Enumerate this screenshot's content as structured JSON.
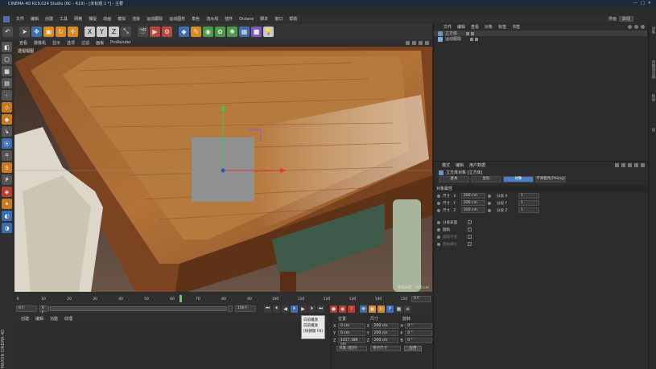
{
  "window": {
    "title": "CINEMA 4D R19.024 Studio (RC - R19) - [未标题 1 *] - 主要"
  },
  "menubar": {
    "items": [
      "文件",
      "编辑",
      "创建",
      "工具",
      "网格",
      "捕捉",
      "动画",
      "模拟",
      "渲染",
      "运动跟踪",
      "运动图形",
      "角色",
      "流水线",
      "插件",
      "Octane",
      "脚本",
      "窗口",
      "帮助"
    ],
    "layout_label": "界面",
    "layout_value": "启动"
  },
  "viewport": {
    "menu": [
      "查看",
      "摄像机",
      "显示",
      "选项",
      "过滤",
      "面板",
      "ProRender"
    ],
    "label": "透视视图",
    "grid_label": "网格间距 : 100 cm"
  },
  "timeline": {
    "ticks": [
      "0",
      "10",
      "20",
      "30",
      "40",
      "50",
      "60",
      "70",
      "80",
      "90",
      "100",
      "110",
      "120",
      "130",
      "140",
      "150"
    ],
    "current_frame": 63,
    "end_label": "0 F"
  },
  "transport": {
    "start_field": "0 F",
    "slider_start": "0 F",
    "slider_end": "150 F",
    "end_field": "150 F"
  },
  "tooltip": {
    "lines": [
      "向前播放",
      "向前播放",
      "[快捷键 F8]"
    ]
  },
  "material_panel": {
    "menu": [
      "创建",
      "编辑",
      "功能",
      "纹理"
    ]
  },
  "coordinates": {
    "headers": [
      "位置",
      "尺寸",
      "旋转"
    ],
    "rows": [
      {
        "axis": "X",
        "pos": "0 cm",
        "size": "200 cm",
        "rot_axis": "H",
        "rot": "0 °"
      },
      {
        "axis": "Y",
        "pos": "0 cm",
        "size": "200 cm",
        "rot_axis": "P",
        "rot": "0 °"
      },
      {
        "axis": "Z",
        "pos": "1417.189 cm",
        "size": "200 cm",
        "rot_axis": "B",
        "rot": "0 °"
      }
    ],
    "mode": "对象 (相对)",
    "size_mode": "绝对尺寸",
    "apply_label": "应用"
  },
  "object_manager": {
    "menu": [
      "文件",
      "编辑",
      "查看",
      "对象",
      "标签",
      "书签"
    ],
    "items": [
      {
        "name": "立方体",
        "selected": true
      },
      {
        "name": "运动跟踪",
        "selected": false
      }
    ]
  },
  "attributes": {
    "menu": [
      "模式",
      "编辑",
      "用户数据"
    ],
    "title": "立方体对象 [立方体]",
    "tabs": [
      "基本",
      "坐标",
      "对象",
      "平滑着色(Phong)"
    ],
    "active_tab": 2,
    "section": "对象属性",
    "props": [
      {
        "label": "尺寸 . X",
        "value": "200 cm",
        "label2": "分段 X",
        "value2": "1"
      },
      {
        "label": "尺寸 . Y",
        "value": "200 cm",
        "label2": "分段 Y",
        "value2": "1"
      },
      {
        "label": "尺寸 . Z",
        "value": "200 cm",
        "label2": "分段 Z",
        "value2": "1"
      }
    ],
    "checks": [
      {
        "label": "分离表面",
        "dim": false
      },
      {
        "label": "圆角",
        "dim": false
      },
      {
        "label": "圆角半径",
        "dim": true
      },
      {
        "label": "圆角细分",
        "dim": true
      }
    ]
  },
  "right_strip": {
    "labels": [
      "对象",
      "内容浏览器",
      "构造",
      "层"
    ]
  },
  "brand": "MAXON CINEMA 4D",
  "colors": {
    "accent": "#4b7fc4",
    "playhead": "#5bd16a",
    "axis_x": "#e23b3b",
    "axis_y": "#3ec54a",
    "axis_z": "#2b52c9"
  }
}
